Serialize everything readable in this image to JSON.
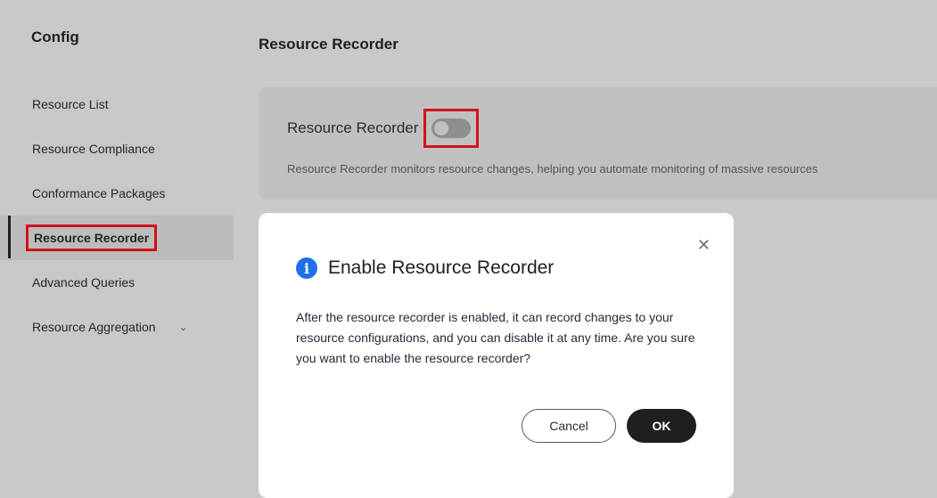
{
  "sidebar": {
    "title": "Config",
    "items": [
      {
        "label": "Resource List"
      },
      {
        "label": "Resource Compliance"
      },
      {
        "label": "Conformance Packages"
      },
      {
        "label": "Resource Recorder"
      },
      {
        "label": "Advanced Queries"
      },
      {
        "label": "Resource Aggregation",
        "icon": "chevron-down-icon"
      }
    ],
    "active_index": 3
  },
  "main": {
    "title": "Resource Recorder",
    "card": {
      "label": "Resource Recorder",
      "toggle_state": "off",
      "description": "Resource Recorder monitors resource changes, helping you automate monitoring of massive resources"
    }
  },
  "dialog": {
    "icon": "info-icon",
    "title": "Enable Resource Recorder",
    "body": "After the resource recorder is enabled, it can record changes to your resource configurations, and you can disable it at any time. Are you sure you want to enable the resource recorder?",
    "cancel_label": "Cancel",
    "ok_label": "OK",
    "close_icon": "close-icon"
  },
  "colors": {
    "highlight_border": "#d0121b",
    "info_icon": "#2070e8",
    "ok_button": "#1f1f1f"
  }
}
